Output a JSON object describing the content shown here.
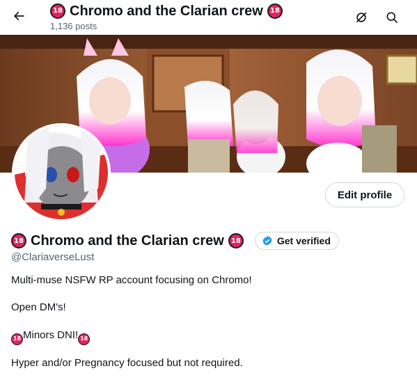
{
  "header": {
    "title": "Chromo and the Clarian crew",
    "badge": "18",
    "posts": "1,136 posts"
  },
  "profile": {
    "display_name": "Chromo and the Clarian crew",
    "badge": "18",
    "handle": "@ClariaverseLust",
    "edit_label": "Edit profile",
    "verify_label": "Get verified"
  },
  "bio": {
    "line1": "Multi-muse NSFW RP account focusing on Chromo!",
    "line2": "Open DM's!",
    "line3": "Minors DNI!",
    "line4": "Hyper and/or Pregnancy focused but not required."
  },
  "colors": {
    "accent": "#1d9bf0",
    "badge_red": "#e0245e",
    "text": "#0f1419",
    "muted": "#536471"
  },
  "icons": [
    "back-arrow-icon",
    "hide-icon",
    "search-icon",
    "verified-badge-icon",
    "age-18-badge-icon"
  ]
}
